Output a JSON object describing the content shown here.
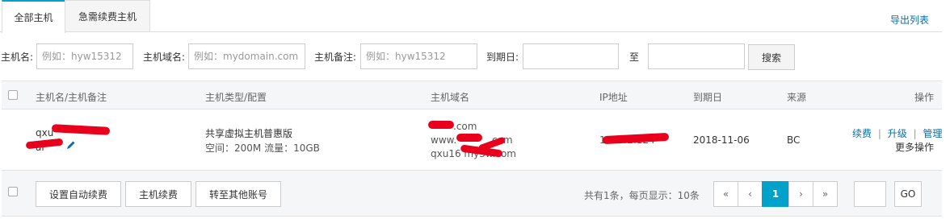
{
  "tabs": [
    {
      "label": "全部主机",
      "active": true
    },
    {
      "label": "急需续费主机",
      "active": false
    }
  ],
  "export_label": "导出列表",
  "filters": {
    "hostname_label": "主机名:",
    "hostname_placeholder": "例如：hyw15312",
    "domain_label": "主机域名:",
    "domain_placeholder": "例如：mydomain.com",
    "note_label": "主机备注:",
    "note_placeholder": "例如：hyw15312",
    "expire_label": "到期日:",
    "to_label": "至",
    "search_label": "搜索"
  },
  "columns": {
    "name": "主机名/主机备注",
    "type": "主机类型/配置",
    "domain": "主机域名",
    "ip": "IP地址",
    "expire": "到期日",
    "source": "来源",
    "action": "操作"
  },
  "row": {
    "name": "qxu",
    "note": "ai",
    "type": "共享虚拟主机普惠版",
    "config": "空间：200M 流量：10GB",
    "domains": [
      ".com",
      "www.",
      "qxu16              my3w.com"
    ],
    "domain_tail": ".com",
    "ip": "121.42.124",
    "expire": "2018-11-06",
    "source": "BC",
    "actions": [
      "续费",
      "升级",
      "管理"
    ],
    "sep": "|",
    "more": "更多操作"
  },
  "footer": {
    "auto_renew": "设置自动续费",
    "renew": "主机续费",
    "transfer": "转至其他账号",
    "page_info": "共有1条，每页显示：10条",
    "pages": [
      "«",
      "‹",
      "1",
      "›",
      "»"
    ],
    "current_page": "1",
    "go": "GO"
  },
  "colors": {
    "accent": "#00a2ca",
    "link": "#0a6ea8",
    "redact": "#e8001c"
  }
}
